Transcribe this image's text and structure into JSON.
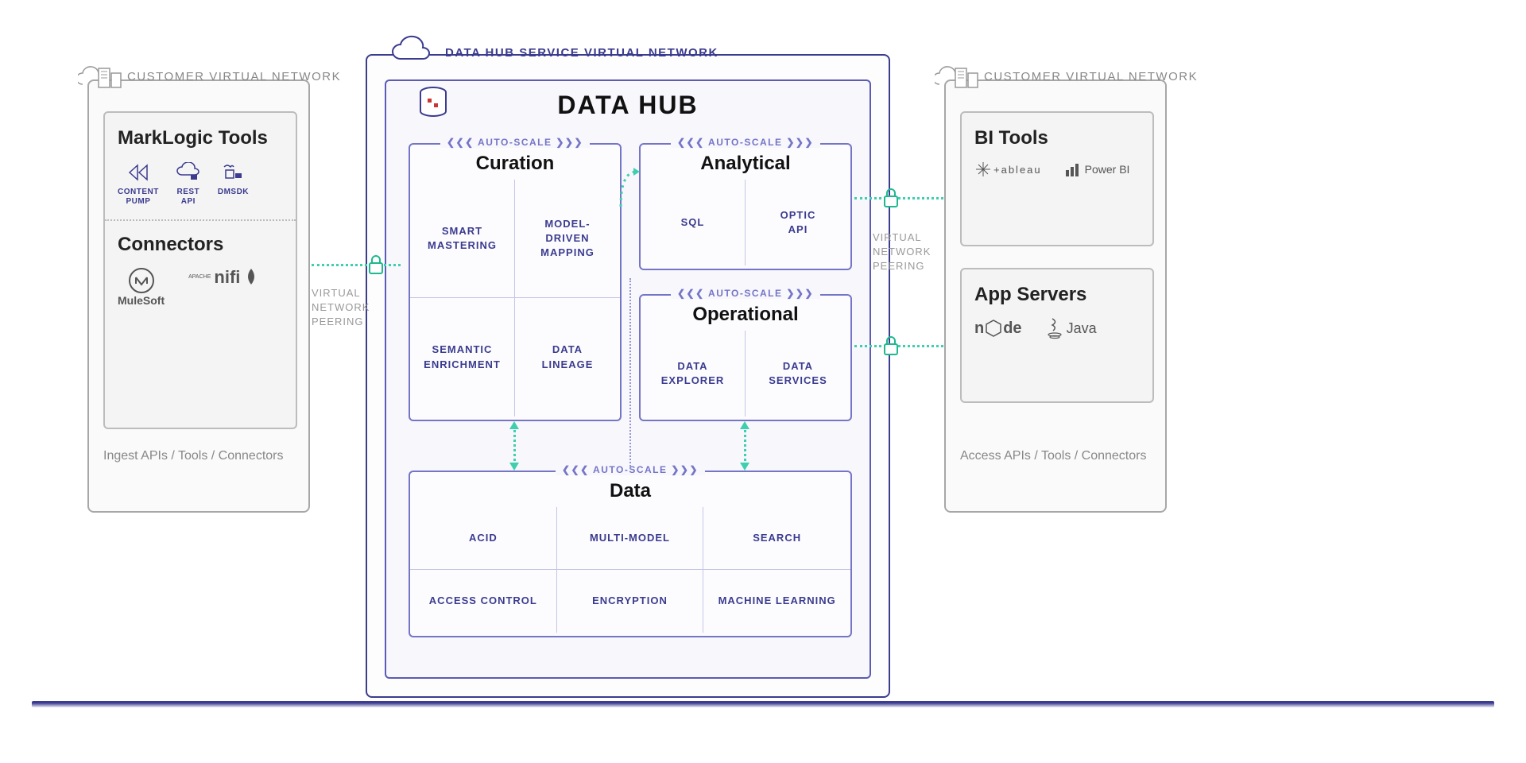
{
  "left_network": {
    "label": "CUSTOMER VIRTUAL NETWORK",
    "panel_ml_title": "MarkLogic Tools",
    "tools": [
      {
        "label": "CONTENT\nPUMP"
      },
      {
        "label": "REST\nAPI"
      },
      {
        "label": "DMSDK"
      }
    ],
    "panel_conn_title": "Connectors",
    "connectors": [
      {
        "name": "MuleSoft"
      },
      {
        "name": "Apache nifi"
      }
    ],
    "footer": "Ingest APIs / Tools / Connectors"
  },
  "dhs": {
    "label": "DATA HUB SERVICE VIRTUAL NETWORK",
    "title": "DATA HUB",
    "autoscale": "AUTO-SCALE",
    "modules": {
      "curation": {
        "title": "Curation",
        "cells": [
          "SMART\nMASTERING",
          "MODEL-\nDRIVEN\nMAPPING",
          "SEMANTIC\nENRICHMENT",
          "DATA\nLINEAGE"
        ]
      },
      "analytical": {
        "title": "Analytical",
        "cells": [
          "SQL",
          "OPTIC\nAPI"
        ]
      },
      "operational": {
        "title": "Operational",
        "cells": [
          "DATA\nEXPLORER",
          "DATA\nSERVICES"
        ]
      },
      "data": {
        "title": "Data",
        "cells": [
          "ACID",
          "MULTI-MODEL",
          "SEARCH",
          "ACCESS CONTROL",
          "ENCRYPTION",
          "MACHINE LEARNING"
        ]
      }
    }
  },
  "right_network": {
    "label": "CUSTOMER VIRTUAL NETWORK",
    "panel_bi_title": "BI Tools",
    "bi_tools": [
      "tableau",
      "Power BI"
    ],
    "panel_app_title": "App Servers",
    "app_servers": [
      "node",
      "Java"
    ],
    "footer": "Access APIs / Tools / Connectors"
  },
  "peering": "VIRTUAL\nNETWORK\nPEERING"
}
